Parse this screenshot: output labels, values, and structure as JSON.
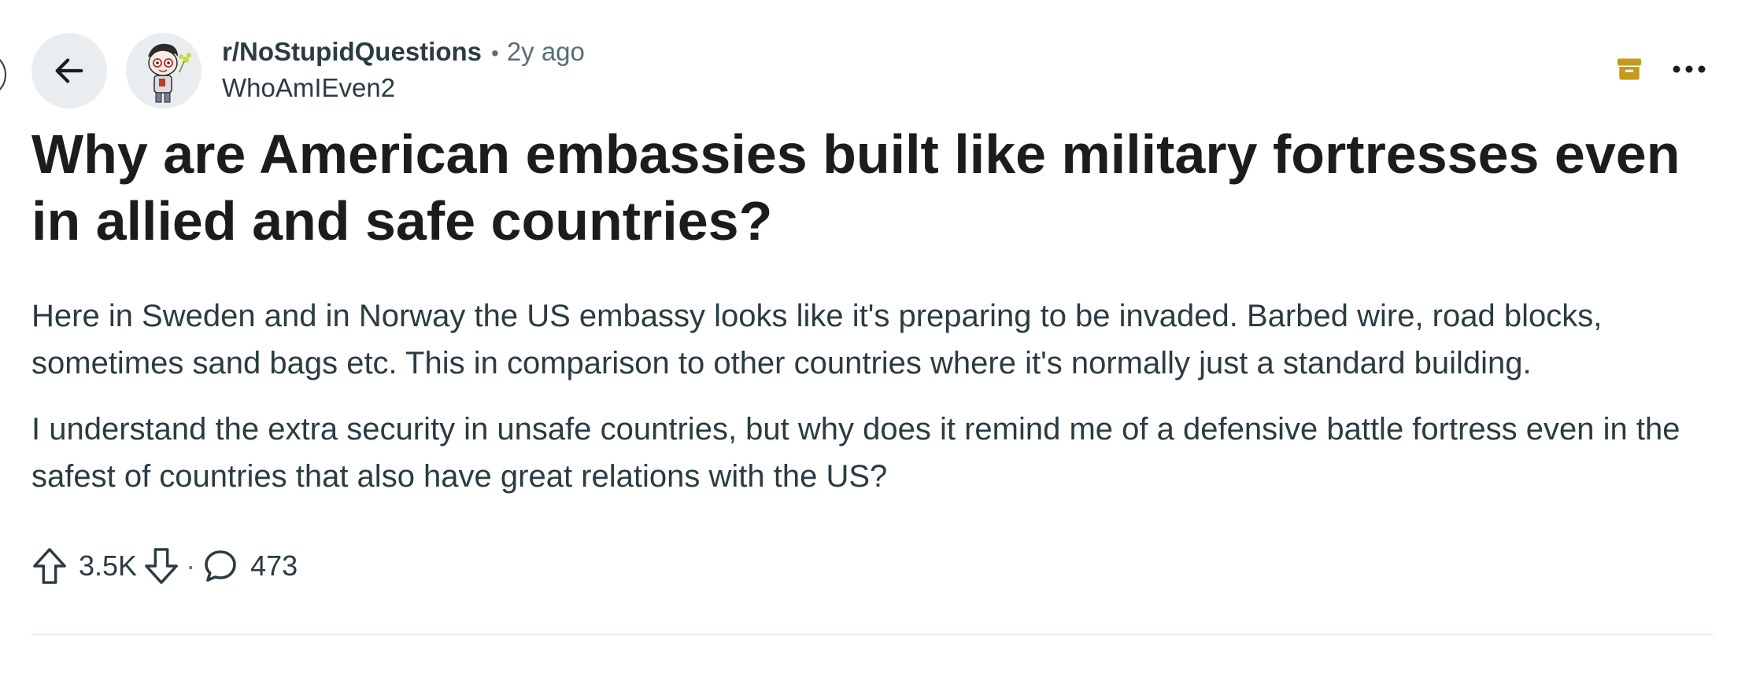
{
  "header": {
    "subreddit": "r/NoStupidQuestions",
    "separator": "•",
    "age": "2y ago",
    "author": "WhoAmIEven2",
    "icons": {
      "back": "arrow-left-icon",
      "archive": "archive-icon",
      "more": "more-horizontal-icon",
      "avatar": "user-avatar"
    },
    "archive_color": "#c49a1a"
  },
  "post": {
    "title": "Why are American embassies built like military fortresses even in allied and safe countries?",
    "paragraphs": [
      "Here in Sweden and in Norway the US embassy looks like it's preparing to be invaded. Barbed wire, road blocks, sometimes sand bags etc. This in comparison to other countries where it's normally just a standard building.",
      "I understand the extra security in unsafe countries, but why does it remind me of a defensive battle fortress even in the safest of countries that also have great relations with the US?"
    ]
  },
  "actions": {
    "score": "3.5K",
    "separator": "·",
    "comments": "473",
    "icons": {
      "upvote": "upvote-arrow-icon",
      "downvote": "downvote-arrow-icon",
      "comment": "comment-bubble-icon"
    }
  }
}
